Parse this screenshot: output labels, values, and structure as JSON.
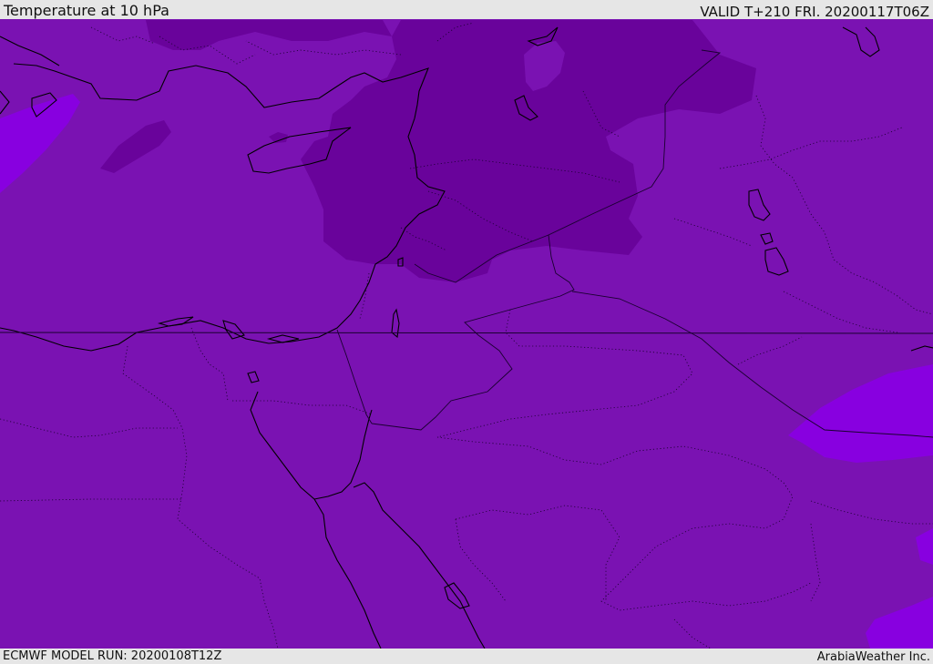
{
  "header": {
    "title": "Temperature at 10 hPa",
    "valid": "VALID T+210 FRI. 20200117T06Z"
  },
  "footer": {
    "model_run": "ECMWF MODEL RUN: 20200108T12Z",
    "credit": "ArabiaWeather Inc."
  },
  "map": {
    "colors": {
      "base": "#7a12b2",
      "cold_zone": "#69039b",
      "warm_zone": "#8800e0",
      "coastline": "#000000",
      "border": "#1a0030"
    }
  }
}
